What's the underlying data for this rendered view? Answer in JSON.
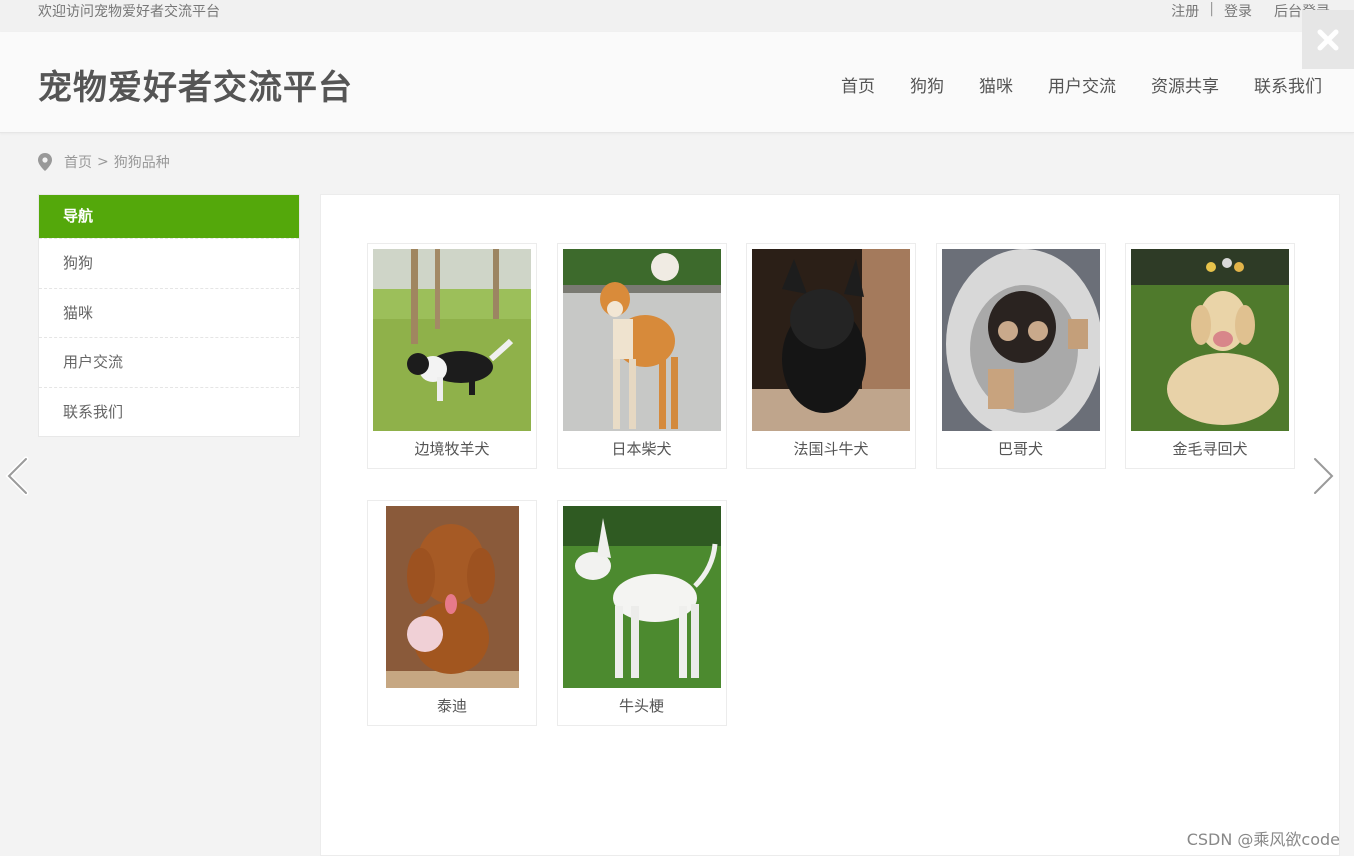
{
  "topbar": {
    "welcome": "欢迎访问宠物爱好者交流平台",
    "register": "注册",
    "separator": "|",
    "login": "登录",
    "admin_login": "后台登录"
  },
  "header": {
    "logo": "宠物爱好者交流平台",
    "nav": [
      "首页",
      "狗狗",
      "猫咪",
      "用户交流",
      "资源共享",
      "联系我们"
    ]
  },
  "breadcrumb": {
    "home": "首页",
    "separator": ">",
    "current": "狗狗品种"
  },
  "sidebar": {
    "title": "导航",
    "items": [
      "狗狗",
      "猫咪",
      "用户交流",
      "联系我们"
    ]
  },
  "dogs": [
    {
      "name": "边境牧羊犬"
    },
    {
      "name": "日本柴犬"
    },
    {
      "name": "法国斗牛犬"
    },
    {
      "name": "巴哥犬"
    },
    {
      "name": "金毛寻回犬"
    },
    {
      "name": "泰迪"
    },
    {
      "name": "牛头梗"
    }
  ],
  "watermark": "CSDN @乘风欲code",
  "colors": {
    "accent": "#54a80b",
    "background": "#f3f3f3"
  },
  "icons": {
    "close": "close-icon",
    "location": "location-pin-icon",
    "prev": "chevron-left-icon",
    "next": "chevron-right-icon"
  }
}
